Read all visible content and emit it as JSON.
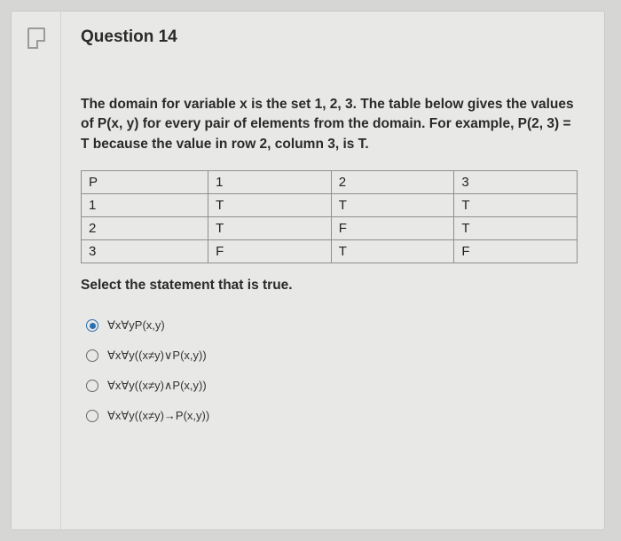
{
  "question": {
    "title": "Question 14",
    "prompt": "The domain for variable x is the set 1, 2, 3. The table below gives the values of P(x, y) for every pair of elements from the domain. For example, P(2, 3) = T because the value in row 2, column 3, is T.",
    "select_line": "Select the statement that is true."
  },
  "table": {
    "header": [
      "P",
      "1",
      "2",
      "3"
    ],
    "rows": [
      [
        "1",
        "T",
        "T",
        "T"
      ],
      [
        "2",
        "T",
        "F",
        "T"
      ],
      [
        "3",
        "F",
        "T",
        "F"
      ]
    ]
  },
  "options": [
    {
      "label": "∀x∀yP(x,y)",
      "selected": true
    },
    {
      "label": "∀x∀y((x≠y)∨P(x,y))",
      "selected": false
    },
    {
      "label": "∀x∀y((x≠y)∧P(x,y))",
      "selected": false
    },
    {
      "label": "∀x∀y((x≠y)→P(x,y))",
      "selected": false
    }
  ]
}
